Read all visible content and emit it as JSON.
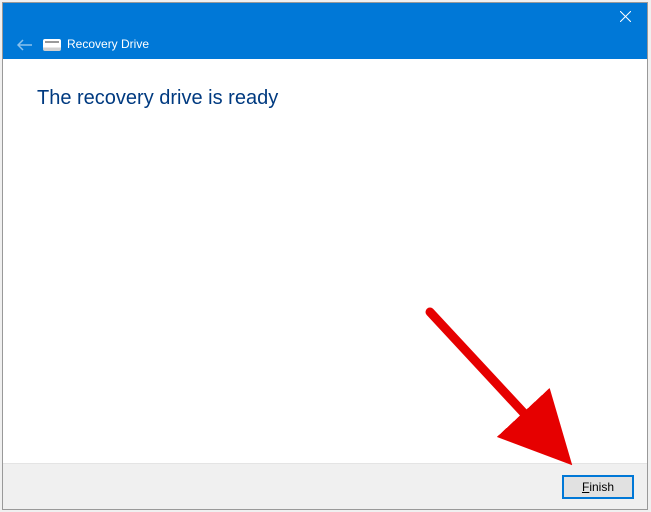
{
  "titlebar": {
    "app_title": "Recovery Drive"
  },
  "content": {
    "headline": "The recovery drive is ready"
  },
  "footer": {
    "finish_first_letter": "F",
    "finish_rest": "inish"
  },
  "icons": {
    "close": "close-icon",
    "back": "back-arrow-icon",
    "drive": "drive-icon"
  },
  "annotation": {
    "arrow_color": "#e60000"
  }
}
